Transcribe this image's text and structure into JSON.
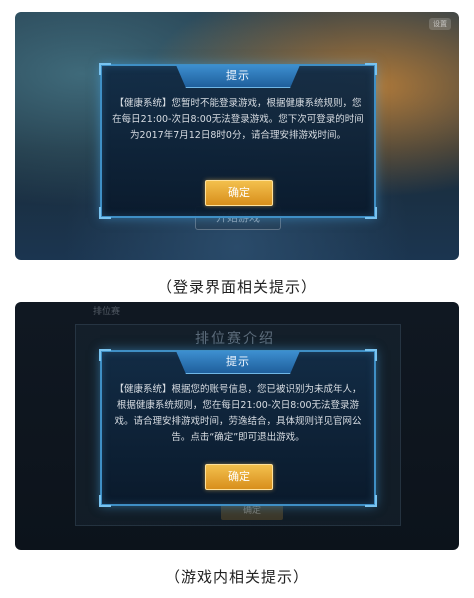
{
  "screenshot1": {
    "corner_chip": "设置",
    "start_game_label": "开始游戏",
    "dialog": {
      "title": "提示",
      "message": "【健康系统】您暂时不能登录游戏，根据健康系统规则，您在每日21:00-次日8:00无法登录游戏。您下次可登录的时间为2017年7月12日8时0分，请合理安排游戏时间。",
      "confirm_label": "确定"
    },
    "caption": "（登录界面相关提示）"
  },
  "screenshot2": {
    "background_title": "排位赛介绍",
    "background_tab": "排位赛",
    "background_button": "确定",
    "dialog": {
      "title": "提示",
      "message": "【健康系统】根据您的账号信息，您已被识别为未成年人，根据健康系统规则，您在每日21:00-次日8:00无法登录游戏。请合理安排游戏时间，劳逸结合，具体规则详见官网公告。点击“确定”即可退出游戏。",
      "confirm_label": "确定"
    },
    "caption": "（游戏内相关提示）"
  },
  "colors": {
    "dialog_border": "#3f8fc5",
    "dialog_header": "#2f7ab8",
    "confirm_button": "#e8a531",
    "dialog_text": "#d8dde3"
  }
}
